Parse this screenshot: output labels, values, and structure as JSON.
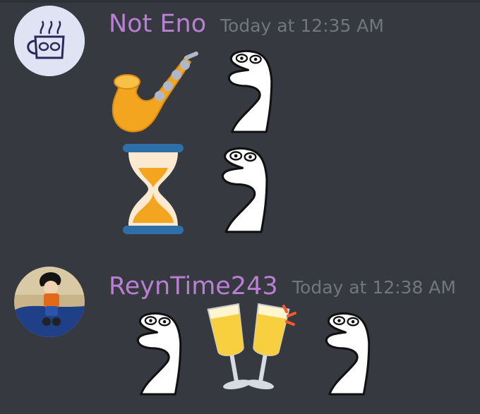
{
  "messages": [
    {
      "author": "Not Eno",
      "timestamp": "Today at 12:35 AM",
      "author_color": "#b97fd3",
      "avatar": "coffee-mug-sketch",
      "lines": [
        [
          "saxophone-emoji",
          "snake-custom-emoji"
        ],
        [
          "hourglass-emoji",
          "snake-custom-emoji"
        ]
      ]
    },
    {
      "author": "ReynTime243",
      "timestamp": "Today at 12:38 AM",
      "author_color": "#b97fd3",
      "avatar": "anime-figure-photo",
      "lines": [
        [
          "snake-custom-emoji",
          "clinking-glasses-emoji",
          "snake-custom-emoji"
        ]
      ]
    }
  ],
  "colors": {
    "background": "#36393f",
    "timestamp": "#72767d",
    "username": "#b97fd3"
  }
}
